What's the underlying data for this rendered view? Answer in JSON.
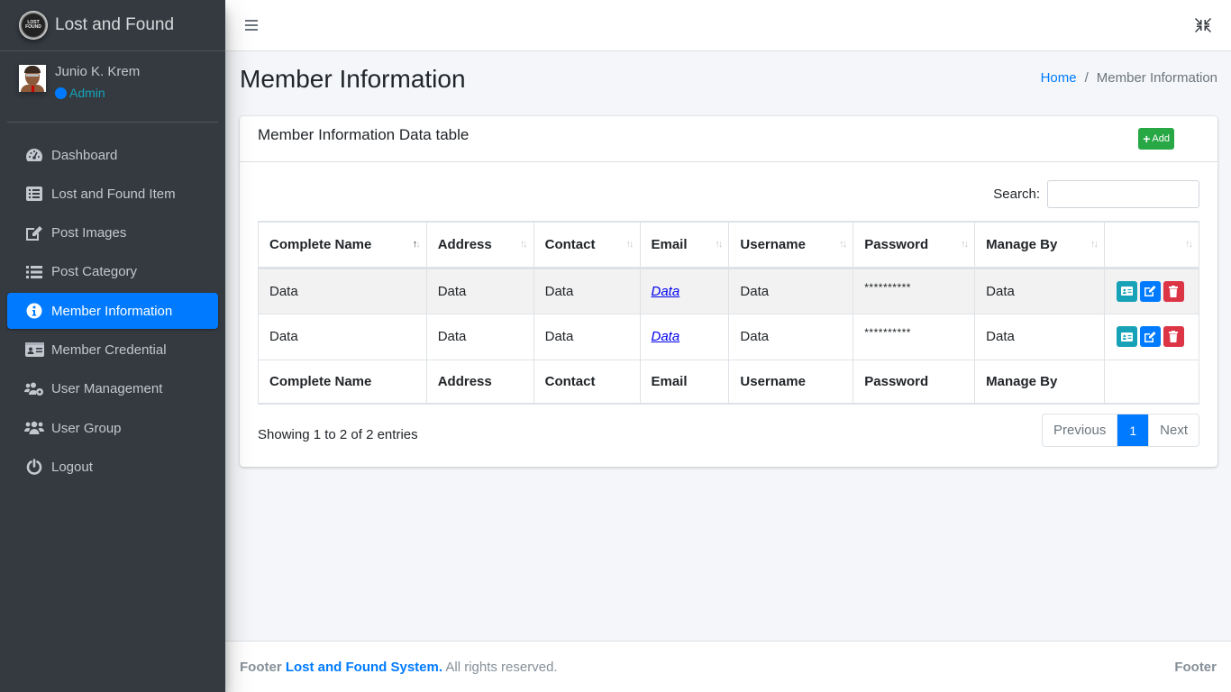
{
  "brand": {
    "title": "Lost and Found",
    "logo_text": "LOST FOUND"
  },
  "user": {
    "name": "Junio K. Krem",
    "role": "Admin"
  },
  "sidebar": {
    "items": [
      {
        "label": "Dashboard",
        "icon": "tachometer-icon",
        "active": false
      },
      {
        "label": "Lost and Found Item",
        "icon": "list-alt-icon",
        "active": false
      },
      {
        "label": "Post Images",
        "icon": "edit-icon",
        "active": false
      },
      {
        "label": "Post Category",
        "icon": "list-icon",
        "active": false
      },
      {
        "label": "Member Information",
        "icon": "info-circle-icon",
        "active": true
      },
      {
        "label": "Member Credential",
        "icon": "id-card-icon",
        "active": false
      },
      {
        "label": "User Management",
        "icon": "users-cog-icon",
        "active": false
      },
      {
        "label": "User Group",
        "icon": "users-icon",
        "active": false
      },
      {
        "label": "Logout",
        "icon": "power-off-icon",
        "active": false
      }
    ]
  },
  "header": {
    "menu_icon": "bars-icon",
    "fullscreen_icon": "compress-icon"
  },
  "page": {
    "title": "Member Information",
    "breadcrumb": {
      "home": "Home",
      "separator": "/",
      "current": "Member Information"
    }
  },
  "card": {
    "title": "Member Information Data table",
    "add_label": "Add",
    "search_label": "Search:",
    "search_value": "",
    "columns": [
      "Complete Name",
      "Address",
      "Contact",
      "Email",
      "Username",
      "Password",
      "Manage By",
      ""
    ],
    "sorted_column": "Complete Name",
    "sort_direction": "asc",
    "rows": [
      {
        "name": "Data",
        "address": "Data",
        "contact": "Data",
        "email": "Data",
        "username": "Data",
        "password": "**********",
        "manage_by": "Data"
      },
      {
        "name": "Data",
        "address": "Data",
        "contact": "Data",
        "email": "Data",
        "username": "Data",
        "password": "**********",
        "manage_by": "Data"
      }
    ],
    "info": "Showing 1 to 2 of 2 entries",
    "pagination": {
      "previous": "Previous",
      "current": "1",
      "next": "Next"
    }
  },
  "footer": {
    "prefix": "Footer",
    "system_name": "Lost and Found System.",
    "rights": "All rights reserved.",
    "right_text": "Footer"
  },
  "colors": {
    "sidebar_bg": "#343a40",
    "primary": "#007bff",
    "success": "#28a745",
    "info": "#17a2b8",
    "danger": "#dc3545"
  }
}
